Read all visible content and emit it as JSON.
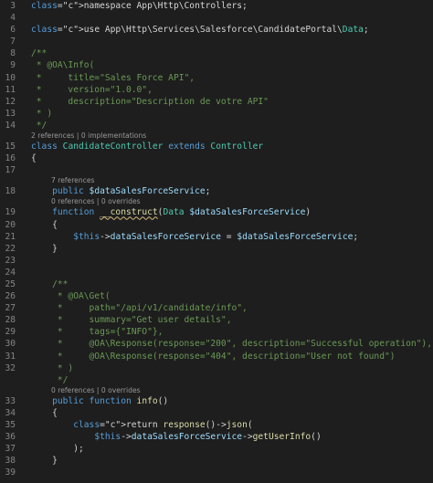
{
  "editor": {
    "rows": [
      {
        "ln": "3",
        "type": "code",
        "text": "namespace App\\Http\\Controllers;"
      },
      {
        "ln": "4",
        "type": "code",
        "text": ""
      },
      {
        "ln": "6",
        "type": "code",
        "text": "use App\\Http\\Services\\Salesforce\\CandidatePortal\\Data;"
      },
      {
        "ln": "7",
        "type": "code",
        "text": ""
      },
      {
        "ln": "8",
        "type": "code",
        "text": "/**"
      },
      {
        "ln": "9",
        "type": "code",
        "text": " * @OA\\Info("
      },
      {
        "ln": "10",
        "type": "code",
        "text": " *     title=\"Sales Force API\","
      },
      {
        "ln": "11",
        "type": "code",
        "text": " *     version=\"1.0.0\","
      },
      {
        "ln": "12",
        "type": "code",
        "text": " *     description=\"Description de votre API\""
      },
      {
        "ln": "13",
        "type": "code",
        "text": " * )"
      },
      {
        "ln": "14",
        "type": "code",
        "text": " */"
      },
      {
        "type": "lens",
        "text": "2 references | 0 implementations"
      },
      {
        "ln": "15",
        "type": "code",
        "text": "class CandidateController extends Controller"
      },
      {
        "ln": "16",
        "type": "code",
        "text": "{"
      },
      {
        "ln": "17",
        "type": "code",
        "text": ""
      },
      {
        "type": "lens",
        "text": "7 references"
      },
      {
        "ln": "18",
        "type": "code",
        "text": "    public $dataSalesForceService;"
      },
      {
        "type": "lens",
        "text": "0 references | 0 overrides"
      },
      {
        "ln": "19",
        "type": "code",
        "text": "    function __construct(Data $dataSalesForceService)"
      },
      {
        "ln": "20",
        "type": "code",
        "text": "    {"
      },
      {
        "ln": "21",
        "type": "code",
        "text": "        $this->dataSalesForceService = $dataSalesForceService;"
      },
      {
        "ln": "22",
        "type": "code",
        "text": "    }"
      },
      {
        "ln": "23",
        "type": "code",
        "text": ""
      },
      {
        "ln": "24",
        "type": "code",
        "text": ""
      },
      {
        "ln": "25",
        "type": "code",
        "text": "    /**"
      },
      {
        "ln": "26",
        "type": "code",
        "text": "     * @OA\\Get("
      },
      {
        "ln": "27",
        "type": "code",
        "text": "     *     path=\"/api/v1/candidate/info\","
      },
      {
        "ln": "28",
        "type": "code",
        "text": "     *     summary=\"Get user details\","
      },
      {
        "ln": "29",
        "type": "code",
        "text": "     *     tags={\"INFO\"},"
      },
      {
        "ln": "30",
        "type": "code",
        "text": "     *     @OA\\Response(response=\"200\", description=\"Successful operation\"),"
      },
      {
        "ln": "31",
        "type": "code",
        "text": "     *     @OA\\Response(response=\"404\", description=\"User not found\")"
      },
      {
        "ln": "32",
        "type": "code",
        "text": "     * )"
      },
      {
        "ln": "",
        "type": "code",
        "text": "     */"
      },
      {
        "type": "lens",
        "text": "0 references | 0 overrides"
      },
      {
        "ln": "33",
        "type": "code",
        "text": "    public function info()"
      },
      {
        "ln": "34",
        "type": "code",
        "text": "    {"
      },
      {
        "ln": "35",
        "type": "code",
        "text": "        return response()->json("
      },
      {
        "ln": "36",
        "type": "code",
        "text": "            $this->dataSalesForceService->getUserInfo()"
      },
      {
        "ln": "37",
        "type": "code",
        "text": "        );"
      },
      {
        "ln": "38",
        "type": "code",
        "text": "    }"
      },
      {
        "ln": "39",
        "type": "code",
        "text": ""
      }
    ]
  },
  "colors": {
    "background": "#1e1e1e",
    "keyword": "#569cd6",
    "control": "#c586c0",
    "type": "#4ec9b0",
    "variable": "#9cdcfe",
    "function": "#dcdcaa",
    "comment": "#6a9955",
    "string": "#ce9178"
  }
}
